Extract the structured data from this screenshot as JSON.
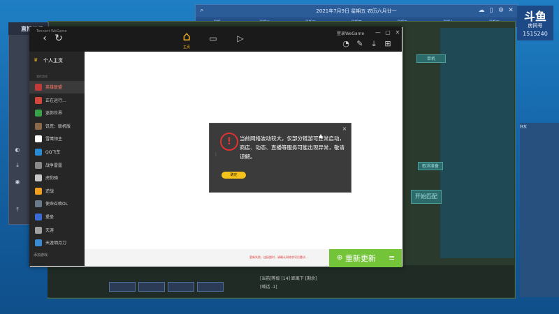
{
  "calendar": {
    "date_text": "2021年7月9日 星期五 农历六月廿一",
    "days": [
      "星期一",
      "星期二",
      "星期三",
      "星期四",
      "星期五",
      "星期六",
      "星期日"
    ]
  },
  "stream_widget": {
    "logo": "斗鱼",
    "label": "房间号",
    "room_id": "1515240"
  },
  "game": {
    "panel_buttons": [
      "单机",
      "开始匹配",
      "取消准备"
    ],
    "chat_line": "[当前]等级 [14] 距离下 [剩余]",
    "chat_input": "[喊话 -1]",
    "side_tab": "好友"
  },
  "left_app": {
    "title": "直播伴侣"
  },
  "wegame": {
    "brand": "Tencent WeGame",
    "home_label": "主页",
    "user": "登录WeGame",
    "personal": "个人主页",
    "section": "我的游戏",
    "items": [
      {
        "label": "英雄联盟",
        "color": "#c03a3a",
        "active": true
      },
      {
        "label": "正在运行...",
        "color": "#d4463a"
      },
      {
        "label": "迷你世界",
        "color": "#3aa04a"
      },
      {
        "label": "饥荒：联机版",
        "color": "#8a6a4a"
      },
      {
        "label": "雪鹰领主",
        "color": "#ffffff"
      },
      {
        "label": "QQ飞车",
        "color": "#2a8ad4"
      },
      {
        "label": "战争雷霆",
        "color": "#8a8a8a"
      },
      {
        "label": "虎豹骑",
        "color": "#c8c8c8"
      },
      {
        "label": "逆战",
        "color": "#f0a020"
      },
      {
        "label": "使命召唤OL",
        "color": "#6a7a8a"
      },
      {
        "label": "堡垒",
        "color": "#3a6ad4"
      },
      {
        "label": "天涯",
        "color": "#a0a0a0"
      },
      {
        "label": "天涯明月刀",
        "color": "#3a8ad4"
      }
    ],
    "sidebar_footer": "添加游戏",
    "footer_error": "更新失败，连接超时，请确认网络状况后重试...",
    "update_label": "重新更新",
    "update_menu": "≡"
  },
  "dialog": {
    "message": "当前网络波动较大，仅部分链游可正常启动，商店、动态、直播等服务可能出现异常，敬请谅解。",
    "ok_label": "确定",
    "close": "×"
  },
  "colors": {
    "accent": "#f5b522",
    "update_green": "#74c43a",
    "error_red": "#e03232"
  }
}
